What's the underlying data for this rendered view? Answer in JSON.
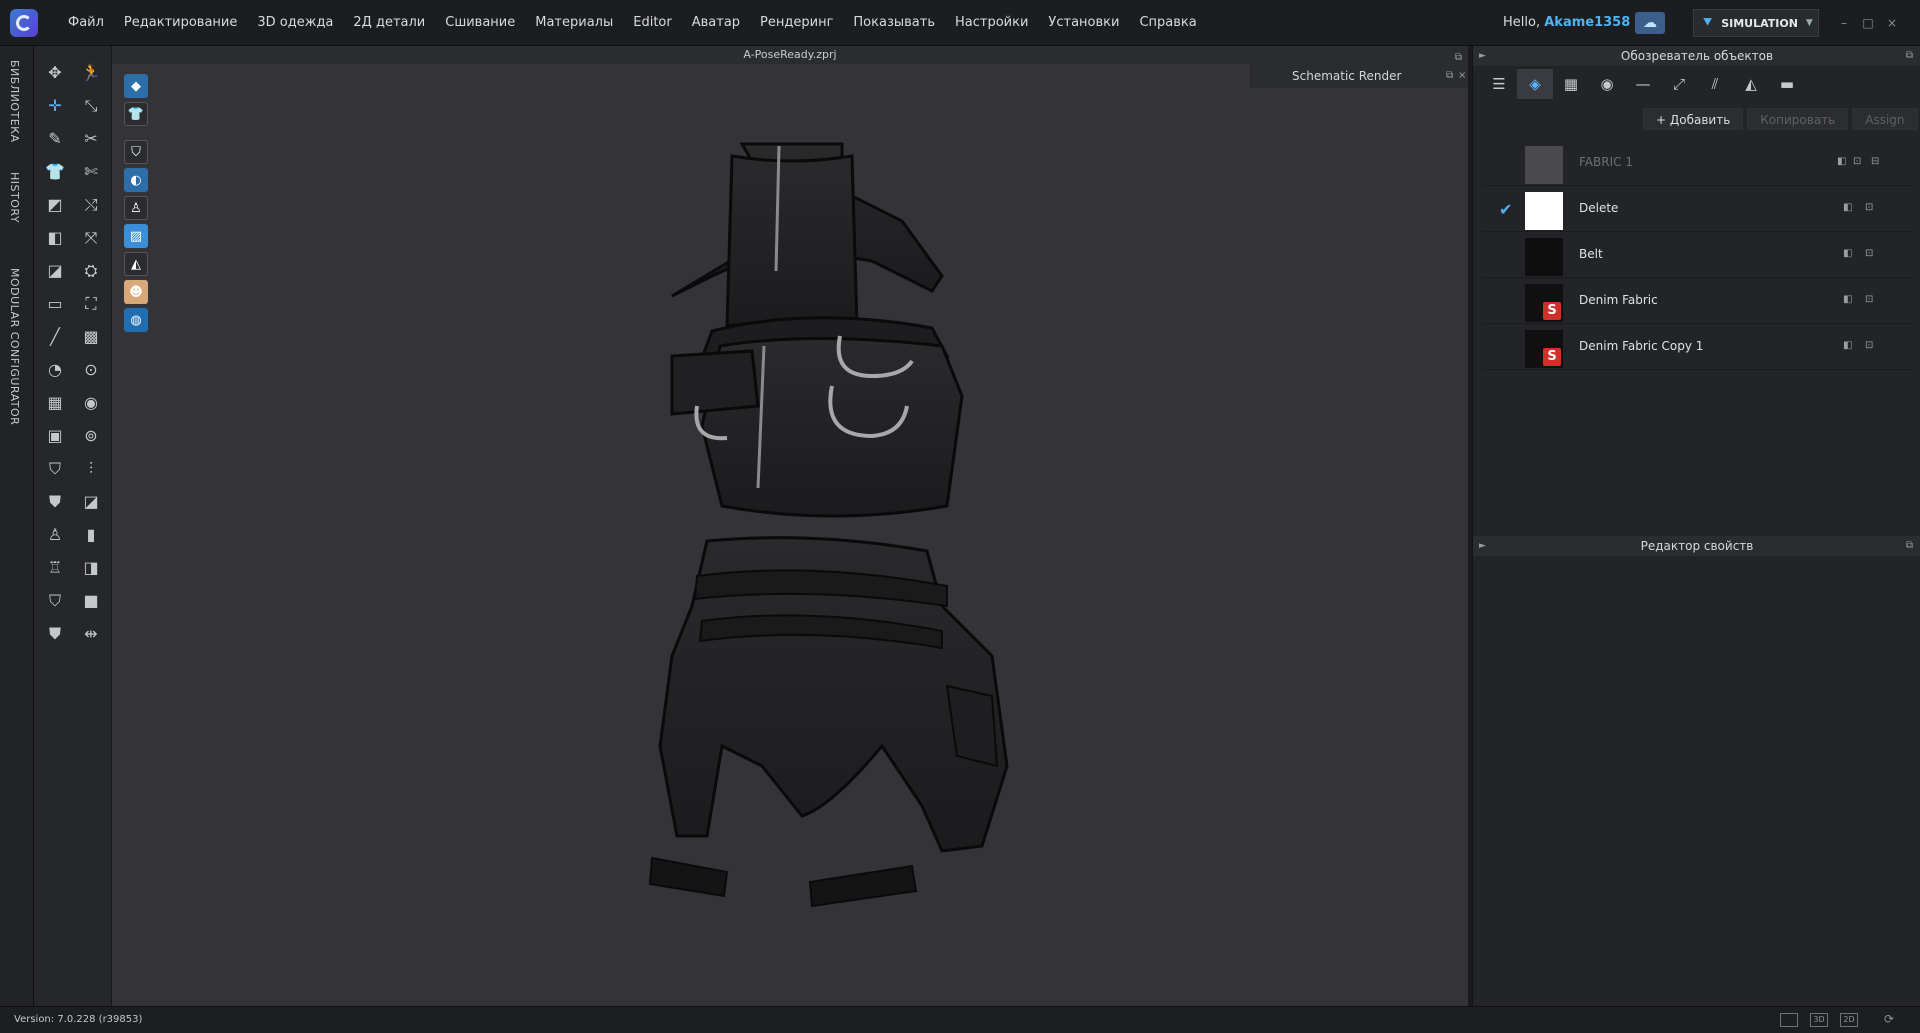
{
  "menubar": {
    "items": [
      "Файл",
      "Редактирование",
      "3D одежда",
      "2Д детали",
      "Сшивание",
      "Материалы",
      "Editor",
      "Аватар",
      "Рендеринг",
      "Показывать",
      "Настройки",
      "Установки",
      "Справка"
    ],
    "hello": "Hello,",
    "user": "Akame1358",
    "mode": "SIMULATION"
  },
  "vertical_tabs": [
    "БИБЛИОТЕКА",
    "HISTORY",
    "MODULAR CONFIGURATOR"
  ],
  "viewport": {
    "title": "A-PoseReady.zprj",
    "schematic_render": "Schematic Render"
  },
  "object_browser": {
    "title": "Обозреватель объектов",
    "add_button": "+ Добавить",
    "copy_button": "Копировать",
    "assign_button": "Assign",
    "fabrics": [
      {
        "name": "FABRIC 1",
        "dim": true,
        "checked": false,
        "thumb_color": "#4a4a4c",
        "logo": false
      },
      {
        "name": "Delete",
        "dim": false,
        "checked": true,
        "thumb_color": "#ffffff",
        "logo": false
      },
      {
        "name": "Belt",
        "dim": false,
        "checked": false,
        "thumb_color": "#0e0e0f",
        "logo": false
      },
      {
        "name": "Denim Fabric",
        "dim": false,
        "checked": false,
        "thumb_color": "#101011",
        "logo": true
      },
      {
        "name": "Denim Fabric Copy 1",
        "dim": false,
        "checked": false,
        "thumb_color": "#101011",
        "logo": true
      }
    ]
  },
  "property_editor": {
    "title": "Редактор свойств"
  },
  "status": {
    "version": "Version: 7.0.228 (r39853)",
    "view_3d": "3D",
    "view_2d": "2D"
  },
  "colors": {
    "accent": "#4fb3f2",
    "viewport_bg": "#343438",
    "panel_bg": "#232427"
  }
}
